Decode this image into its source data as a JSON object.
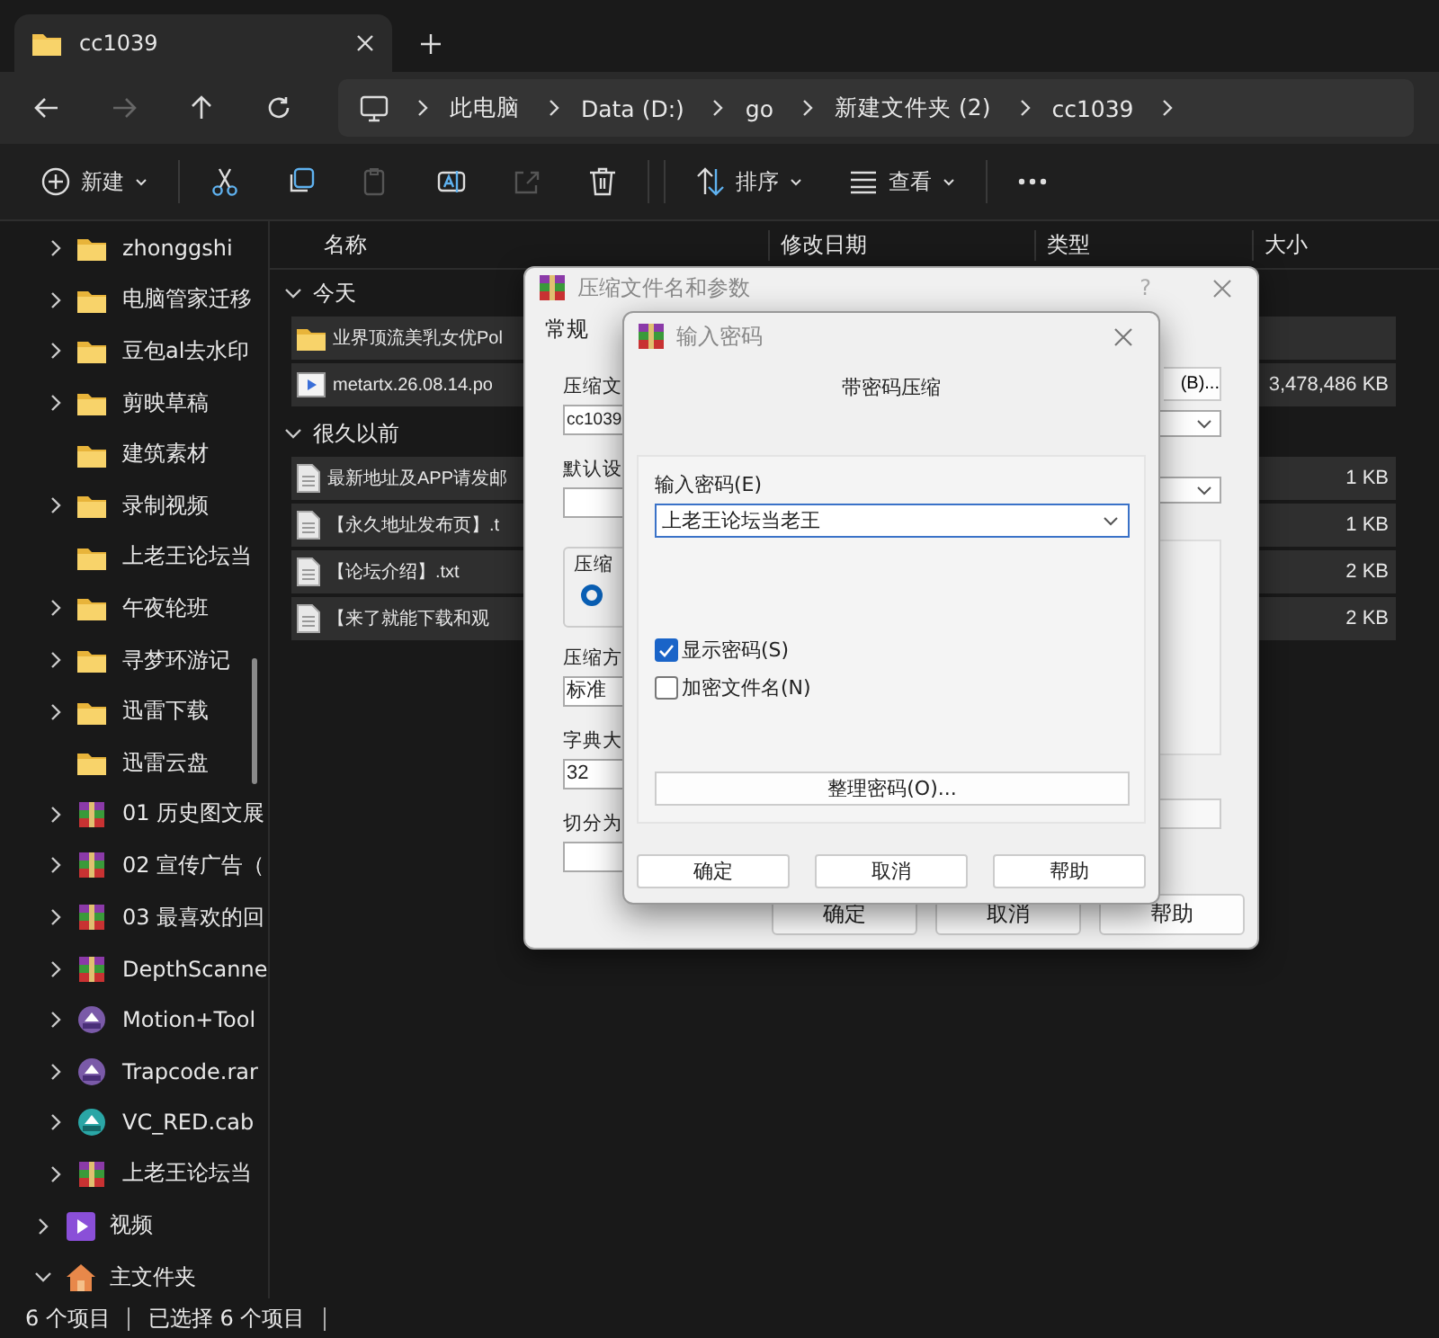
{
  "tab": {
    "title": "cc1039"
  },
  "nav": [
    {
      "kind": "back",
      "disabled": false
    },
    {
      "kind": "forward",
      "disabled": true
    },
    {
      "kind": "up",
      "disabled": false
    },
    {
      "kind": "refresh",
      "disabled": false
    }
  ],
  "breadcrumb": [
    "此电脑",
    "Data (D:)",
    "go",
    "新建文件夹 (2)",
    "cc1039"
  ],
  "toolbar": [
    {
      "kind": "new",
      "label": "新建",
      "disabled": false
    },
    {
      "kind": "cut",
      "disabled": false
    },
    {
      "kind": "copy",
      "disabled": false
    },
    {
      "kind": "paste",
      "disabled": true
    },
    {
      "kind": "rename",
      "disabled": false
    },
    {
      "kind": "share",
      "disabled": true
    },
    {
      "kind": "delete",
      "disabled": false
    },
    {
      "kind": "sort",
      "label": "排序",
      "disabled": false
    },
    {
      "kind": "view",
      "label": "查看",
      "disabled": false
    },
    {
      "kind": "more",
      "disabled": false
    }
  ],
  "sidebar": {
    "subitems": [
      {
        "label": "zhonggshi",
        "kind": "folder",
        "expandable": true
      },
      {
        "label": "电脑管家迁移",
        "kind": "folder",
        "expandable": true
      },
      {
        "label": "豆包al去水印",
        "kind": "folder",
        "expandable": true
      },
      {
        "label": "剪映草稿",
        "kind": "folder",
        "expandable": true
      },
      {
        "label": "建筑素材",
        "kind": "folder",
        "expandable": false
      },
      {
        "label": "录制视频",
        "kind": "folder",
        "expandable": true
      },
      {
        "label": "上老王论坛当",
        "kind": "folder",
        "expandable": false
      },
      {
        "label": "午夜轮班",
        "kind": "folder",
        "expandable": true
      },
      {
        "label": "寻梦环游记",
        "kind": "folder",
        "expandable": true
      },
      {
        "label": "迅雷下载",
        "kind": "folder",
        "expandable": true
      },
      {
        "label": "迅雷云盘",
        "kind": "folder",
        "expandable": false
      },
      {
        "label": "01 历史图文展",
        "kind": "rar",
        "expandable": true
      },
      {
        "label": "02 宣传广告（",
        "kind": "rar",
        "expandable": true
      },
      {
        "label": "03 最喜欢的回",
        "kind": "rar",
        "expandable": true
      },
      {
        "label": "DepthScanne",
        "kind": "rar",
        "expandable": true
      },
      {
        "label": "Motion+Tool",
        "kind": "archive",
        "expandable": true
      },
      {
        "label": "Trapcode.rar",
        "kind": "archive",
        "expandable": true
      },
      {
        "label": "VC_RED.cab",
        "kind": "cab",
        "expandable": true
      },
      {
        "label": "上老王论坛当",
        "kind": "rar",
        "expandable": true
      }
    ],
    "items": [
      {
        "label": "视频",
        "kind": "video",
        "expanded": false
      },
      {
        "label": "主文件夹",
        "kind": "home",
        "expanded": true
      }
    ]
  },
  "columns": [
    "名称",
    "修改日期",
    "类型",
    "大小"
  ],
  "groups": [
    {
      "label": "今天",
      "expanded": true,
      "rows": [
        {
          "name": "业界顶流美乳女优Pol",
          "kind": "folder",
          "selected": true
        },
        {
          "name": "metartx.26.08.14.po",
          "kind": "video",
          "size": "3,478,486 KB",
          "selected": true
        }
      ]
    },
    {
      "label": "很久以前",
      "expanded": true,
      "rows": [
        {
          "name": "最新地址及APP请发邮",
          "kind": "text",
          "size": "1 KB",
          "selected": true
        },
        {
          "name": "【永久地址发布页】.t",
          "kind": "text",
          "size": "1 KB",
          "selected": true
        },
        {
          "name": "【论坛介绍】.txt",
          "kind": "text",
          "size": "2 KB",
          "selected": true
        },
        {
          "name": "【来了就能下载和观",
          "kind": "text",
          "size": "2 KB",
          "selected": true
        }
      ]
    }
  ],
  "status": [
    "6 个项目",
    "已选择 6 个项目"
  ],
  "archive_dialog": {
    "title": "压缩文件名和参数",
    "help": "?",
    "tab": "常规",
    "labels": [
      "压缩文",
      "默认设",
      "压缩方",
      "字典大",
      "切分为"
    ],
    "group_label": "压缩",
    "radio_selected": true,
    "name_value": "cc1039",
    "method_value": "标准",
    "dict_value": "32",
    "browse": "(B)...",
    "buttons": [
      "确定",
      "取消",
      "帮助"
    ]
  },
  "password_dialog": {
    "title": "输入密码",
    "heading": "带密码压缩",
    "field_label": "输入密码(E)",
    "password": "上老王论坛当老王",
    "checkboxes": [
      {
        "label": "显示密码(S)",
        "checked": true
      },
      {
        "label": "加密文件名(N)",
        "checked": false
      }
    ],
    "organize": "整理密码(O)...",
    "buttons": [
      "确定",
      "取消",
      "帮助"
    ]
  }
}
